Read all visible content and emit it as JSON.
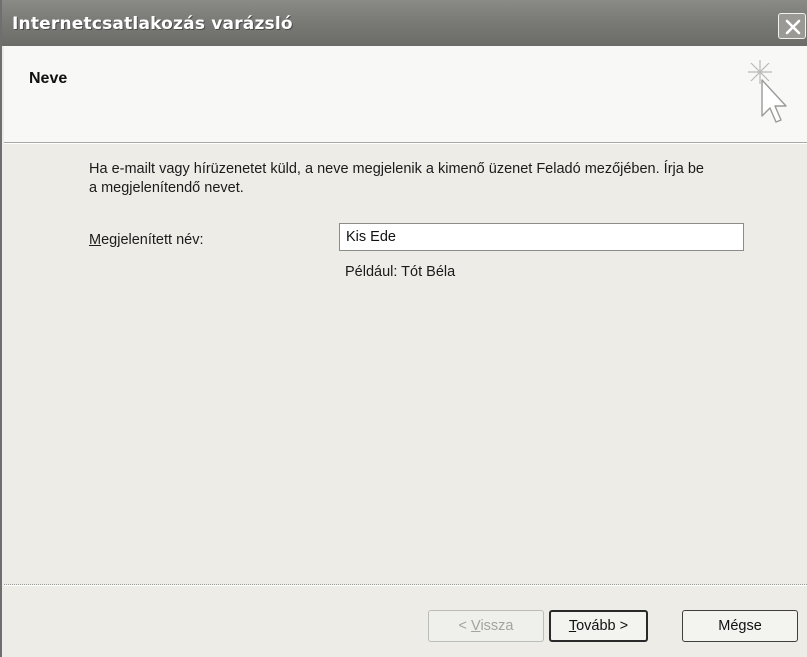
{
  "window": {
    "title": "Internetcsatlakozás varázsló"
  },
  "header": {
    "page_title": "Neve"
  },
  "content": {
    "description": "Ha e-mailt vagy hírüzenetet küld, a neve megjelenik a kimenő üzenet Feladó mezőjében. Írja be a megjelenítendő nevet.",
    "name_label_access_key": "M",
    "name_label_rest": "egjelenített név:",
    "name_value": "Kis Ede",
    "example": "Például: Tót Béla"
  },
  "buttons": {
    "back_prefix": "< ",
    "back_access_key": "V",
    "back_rest": "issza",
    "next_access_key": "T",
    "next_rest": "ovább >",
    "cancel": "Mégse"
  },
  "icons": {
    "close": "close-icon",
    "wizard": "wizard-cursor-icon"
  }
}
